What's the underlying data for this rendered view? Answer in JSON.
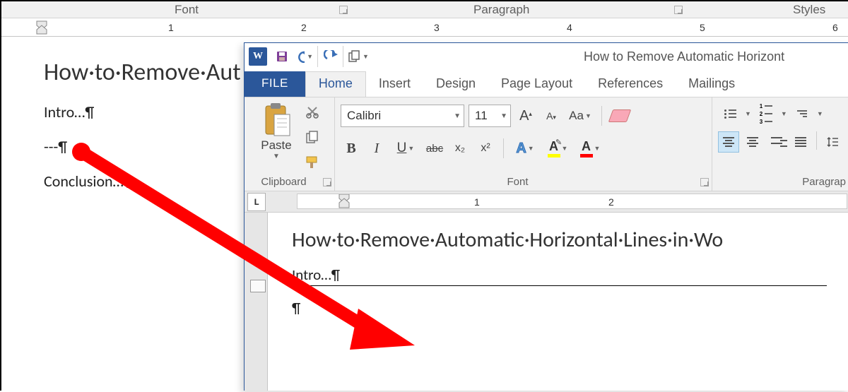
{
  "bg": {
    "ribbon_groups": {
      "font": "Font",
      "paragraph": "Paragraph",
      "styles": "Styles"
    },
    "ruler_numbers": [
      "1",
      "2",
      "3",
      "4",
      "5",
      "6"
    ],
    "doc": {
      "title": "How·to·Remove·Aut",
      "line1": "Intro…¶",
      "line2": "---¶",
      "line3": "Conclusion…¶"
    }
  },
  "fg": {
    "qat": {
      "word": "W"
    },
    "title": "How to Remove Automatic Horizont",
    "tabs": {
      "file": "FILE",
      "home": "Home",
      "insert": "Insert",
      "design": "Design",
      "page_layout": "Page Layout",
      "references": "References",
      "mailings": "Mailings"
    },
    "clipboard": {
      "paste": "Paste",
      "label": "Clipboard"
    },
    "font": {
      "name": "Calibri",
      "size": "11",
      "Aa": "Aa",
      "bold": "B",
      "italic": "I",
      "underline": "U",
      "strike": "abc",
      "sub": "x₂",
      "sup": "x²",
      "textfx": "A",
      "highlight": "A",
      "color": "A",
      "grow": "A",
      "shrink": "A",
      "label": "Font"
    },
    "paragraph": {
      "label": "Paragrap"
    },
    "ruler_numbers": [
      "1",
      "2"
    ],
    "tab_selector": "L",
    "doc": {
      "title": "How·to·Remove·Automatic·Horizontal·Lines·in·Wo",
      "line1": "Intro…¶",
      "line2": "¶"
    }
  }
}
